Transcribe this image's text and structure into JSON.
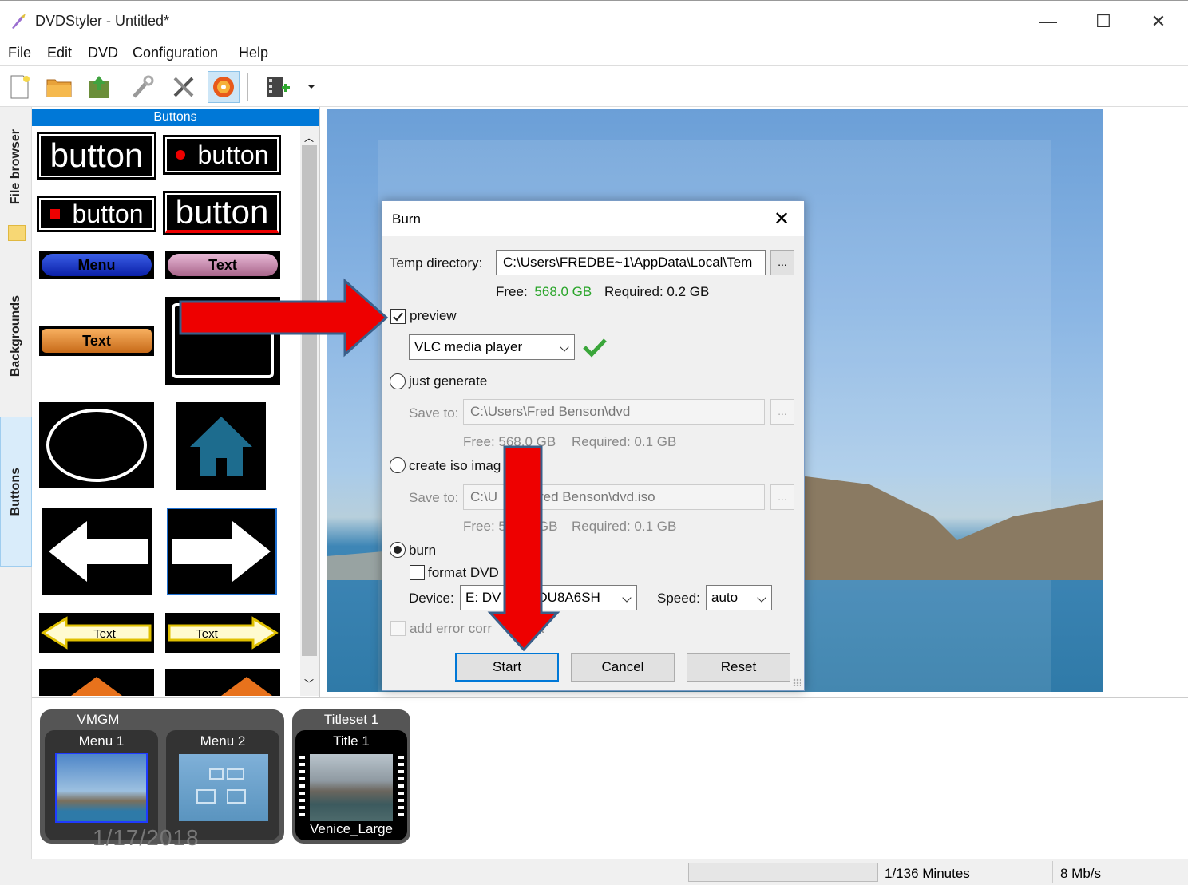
{
  "window": {
    "title": "DVDStyler - Untitled*",
    "minimize": "—",
    "maximize": "☐",
    "close": "✕"
  },
  "menu": [
    "File",
    "Edit",
    "DVD",
    "Configuration",
    "Help"
  ],
  "toolbar": {
    "icons": [
      "new-file-icon",
      "open-folder-icon",
      "save-icon",
      "settings-icon",
      "tools-icon",
      "burn-icon",
      "add-video-icon",
      "dropdown-arrow-icon"
    ]
  },
  "side_tabs": [
    "File browser",
    "Backgrounds",
    "Buttons"
  ],
  "palette": {
    "header": "Buttons",
    "samples": [
      "button",
      "button",
      "button",
      "button",
      "Menu",
      "Text",
      "Text",
      "Text",
      "Text"
    ]
  },
  "dialog": {
    "title": "Burn",
    "close": "✕",
    "temp_dir_label": "Temp directory:",
    "temp_dir_value": "C:\\Users\\FREDBE~1\\AppData\\Local\\Tem",
    "browse": "...",
    "free_label": "Free:",
    "free_value": "568.0 GB",
    "required_label": "Required: 0.2 GB",
    "preview_label": "preview",
    "preview_checked": true,
    "player": "VLC media player",
    "just_generate_label": "just generate",
    "save_to_label": "Save to:",
    "generate_path": "C:\\Users\\Fred Benson\\dvd",
    "generate_free": "Free: 568.0 GB",
    "generate_required": "Required: 0.1 GB",
    "iso_label": "create iso imag",
    "iso_path": "C:\\U",
    "iso_path_tail": "red Benson\\dvd.iso",
    "iso_free": "Free: 5",
    "iso_free_tail": "GB",
    "iso_required": "Required: 0.1 GB",
    "burn_label": "burn",
    "format_label": "format DVD",
    "device_label": "Device:",
    "device_value": "E: DV",
    "device_tail": "DU8A6SH",
    "speed_label": "Speed:",
    "speed_value": "auto",
    "error_label": "add error corr",
    "error_tail": "ata",
    "start": "Start",
    "cancel": "Cancel",
    "reset": "Reset"
  },
  "titleset_strip": {
    "vmgm_label": "VMGM",
    "menu1": "Menu 1",
    "menu2": "Menu 2",
    "titleset_label": "Titleset 1",
    "title1": "Title 1",
    "title1_file": "Venice_Large"
  },
  "statusbar": {
    "minutes": "1/136 Minutes",
    "bitrate": "8 Mb/s"
  },
  "overlay_date": "1/17/2018",
  "colors": {
    "arrow": "#ee0000",
    "arrow_outline": "#3a5f8a",
    "free_value": "#2aa52a",
    "accent": "#0078d7"
  }
}
